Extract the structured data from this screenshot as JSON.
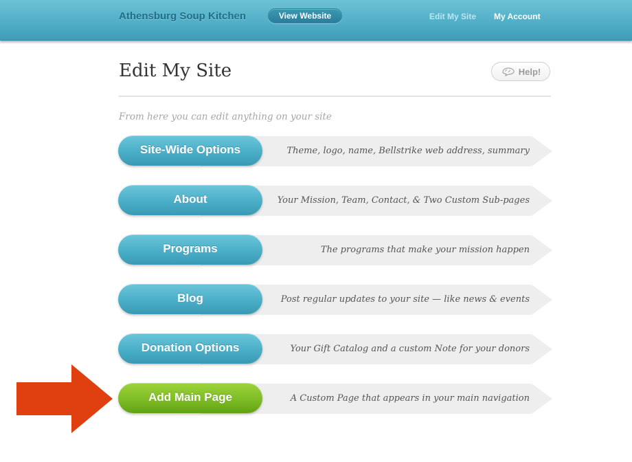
{
  "header": {
    "org_name": "Athensburg Soup Kitchen",
    "view_website_label": "View Website",
    "nav": {
      "edit_my_site": "Edit My Site",
      "my_account": "My Account"
    },
    "colors": {
      "bar": "#4fadc6",
      "org_text": "#1f6f88"
    }
  },
  "main": {
    "title": "Edit My Site",
    "help_label": "Help!",
    "intro": "From here you can edit anything on your site",
    "sections": [
      {
        "label": "Site-Wide Options",
        "description": "Theme, logo, name, Bellstrike web address, summary",
        "color": "blue"
      },
      {
        "label": "About",
        "description": "Your Mission, Team, Contact, & Two Custom Sub-pages",
        "color": "blue"
      },
      {
        "label": "Programs",
        "description": "The programs that make your mission happen",
        "color": "blue"
      },
      {
        "label": "Blog",
        "description": "Post regular updates to your site — like news & events",
        "color": "blue"
      },
      {
        "label": "Donation Options",
        "description": "Your Gift Catalog and a custom Note for your donors",
        "color": "blue"
      },
      {
        "label": "Add Main Page",
        "description": "A Custom Page that appears in your main navigation",
        "color": "green"
      }
    ]
  },
  "annotation": {
    "icon": "arrow-right-icon",
    "color": "#e0400f"
  }
}
